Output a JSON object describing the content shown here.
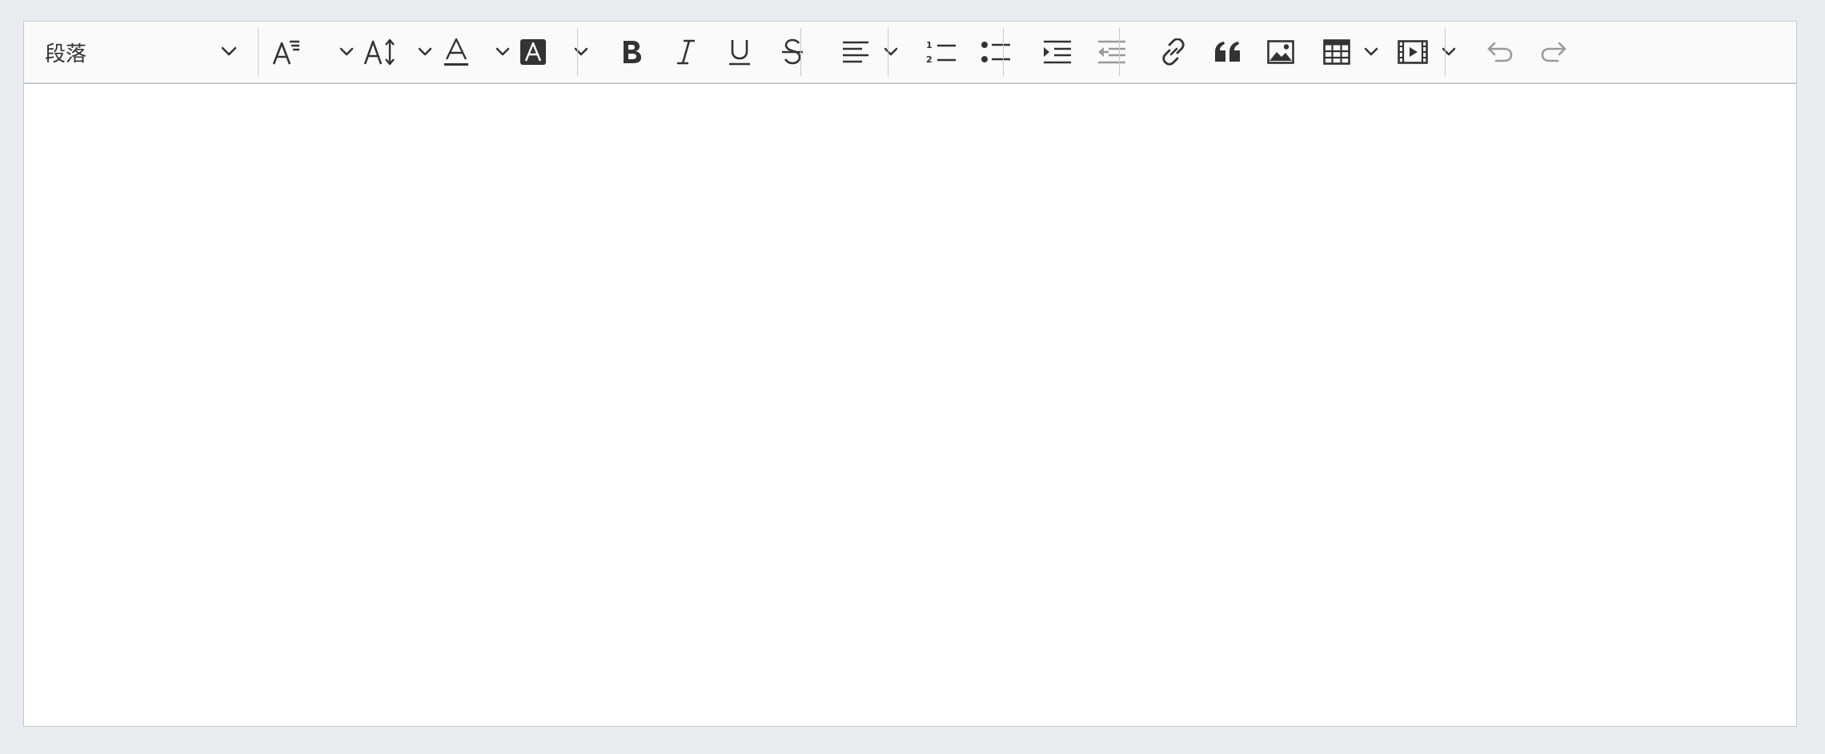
{
  "toolbar": {
    "heading_select": {
      "value": "段落"
    },
    "icons": [
      "font-family-icon",
      "font-size-icon",
      "font-color-icon",
      "font-background-color-icon",
      "bold-icon",
      "italic-icon",
      "underline-icon",
      "strikethrough-icon",
      "text-alignment-icon",
      "numbered-list-icon",
      "bulleted-list-icon",
      "increase-indent-icon",
      "decrease-indent-icon",
      "link-icon",
      "block-quote-icon",
      "insert-image-icon",
      "insert-table-icon",
      "insert-media-icon",
      "undo-icon",
      "redo-icon"
    ],
    "colors": {
      "icon": "#333333",
      "icon_disabled": "#9a9a9a",
      "toolbar_bg": "#fafafa",
      "border": "#c6c8cc",
      "page_bg": "#e9ecf1"
    }
  },
  "content": {
    "text": ""
  }
}
